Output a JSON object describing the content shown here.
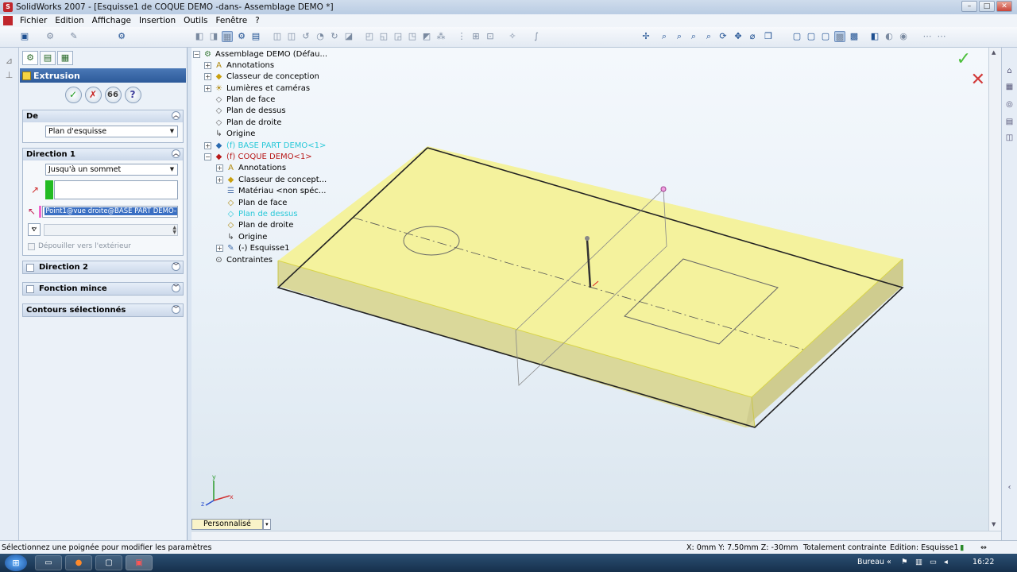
{
  "window": {
    "title": "SolidWorks 2007 - [Esquisse1 de COQUE DEMO -dans- Assemblage DEMO *]",
    "app_icon": "solidworks-logo-icon",
    "buttons": {
      "minimize": "–",
      "maximize": "□",
      "close": "✕"
    }
  },
  "menu": {
    "items": [
      "Fichier",
      "Edition",
      "Affichage",
      "Insertion",
      "Outils",
      "Fenêtre",
      "?"
    ]
  },
  "feature_manager": {
    "header": "Extrusion",
    "actions": {
      "ok": "✓",
      "cancel": "✗",
      "preview": "66",
      "help": "?"
    },
    "groups": {
      "de": {
        "title": "De",
        "select_value": "Plan d'esquisse"
      },
      "direction1": {
        "title": "Direction 1",
        "select_value": "Jusqu'à un sommet",
        "vertex_value": "Point1@vue droite@BASE PART DEMO-",
        "draft_label": "Dépouiller vers l'extérieur"
      },
      "direction2": {
        "title": "Direction 2"
      },
      "thin": {
        "title": "Fonction mince"
      },
      "contours": {
        "title": "Contours sélectionnés"
      }
    },
    "colors": {
      "green_swatch": "#22bb22",
      "pink_swatch": "#ee66cc",
      "header": "#3b69a8"
    }
  },
  "tree": {
    "root": "Assemblage DEMO  (Défau...",
    "items": [
      "Annotations",
      "Classeur de conception",
      "Lumières et caméras",
      "Plan de face",
      "Plan de dessus",
      "Plan de droite",
      "Origine",
      "(f) BASE PART DEMO<1>",
      "(f) COQUE DEMO<1>",
      "Annotations",
      "Classeur de concept...",
      "Matériau <non spéc...",
      "Plan de face",
      "Plan de dessus",
      "Plan de droite",
      "Origine",
      "(-) Esquisse1",
      "Contraintes"
    ]
  },
  "viewport": {
    "confirm_icon": "✓",
    "cancel_icon": "✕",
    "tab_label": "Personnalisé",
    "part_color": "#f5f29a"
  },
  "status": {
    "message": "Sélectionnez une poignée pour modifier les paramètres",
    "coords": "X: 0mm  Y: 7.50mm  Z: -30mm",
    "constraint": "Totalement contrainte",
    "edition": "Edition: Esquisse1"
  },
  "taskbar": {
    "tray_label": "Bureau",
    "clock": "16:22"
  }
}
